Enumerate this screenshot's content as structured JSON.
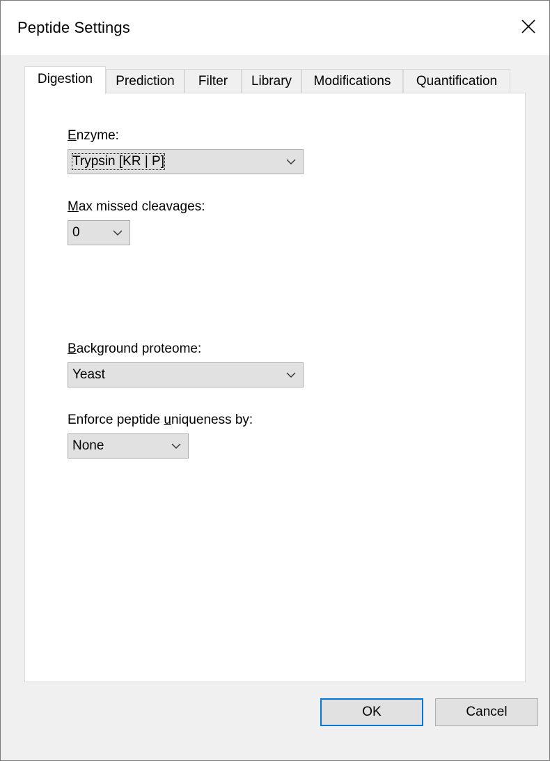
{
  "window": {
    "title": "Peptide Settings"
  },
  "tabs": [
    {
      "label": "Digestion",
      "active": true
    },
    {
      "label": "Prediction",
      "active": false
    },
    {
      "label": "Filter",
      "active": false
    },
    {
      "label": "Library",
      "active": false
    },
    {
      "label": "Modifications",
      "active": false
    },
    {
      "label": "Quantification",
      "active": false
    }
  ],
  "digestion": {
    "enzyme": {
      "label": "Enzyme:",
      "mnemonic": "E",
      "value": "Trypsin [KR | P]"
    },
    "max_missed_cleavages": {
      "label": "Max missed cleavages:",
      "mnemonic": "M",
      "value": "0"
    },
    "background_proteome": {
      "label": "Background proteome:",
      "mnemonic": "B",
      "value": "Yeast"
    },
    "uniqueness": {
      "label": "Enforce peptide uniqueness by:",
      "mnemonic": "u",
      "value": "None"
    }
  },
  "buttons": {
    "ok": "OK",
    "cancel": "Cancel"
  },
  "icons": {
    "close": "close-icon",
    "dropdown": "chevron-down-icon"
  }
}
